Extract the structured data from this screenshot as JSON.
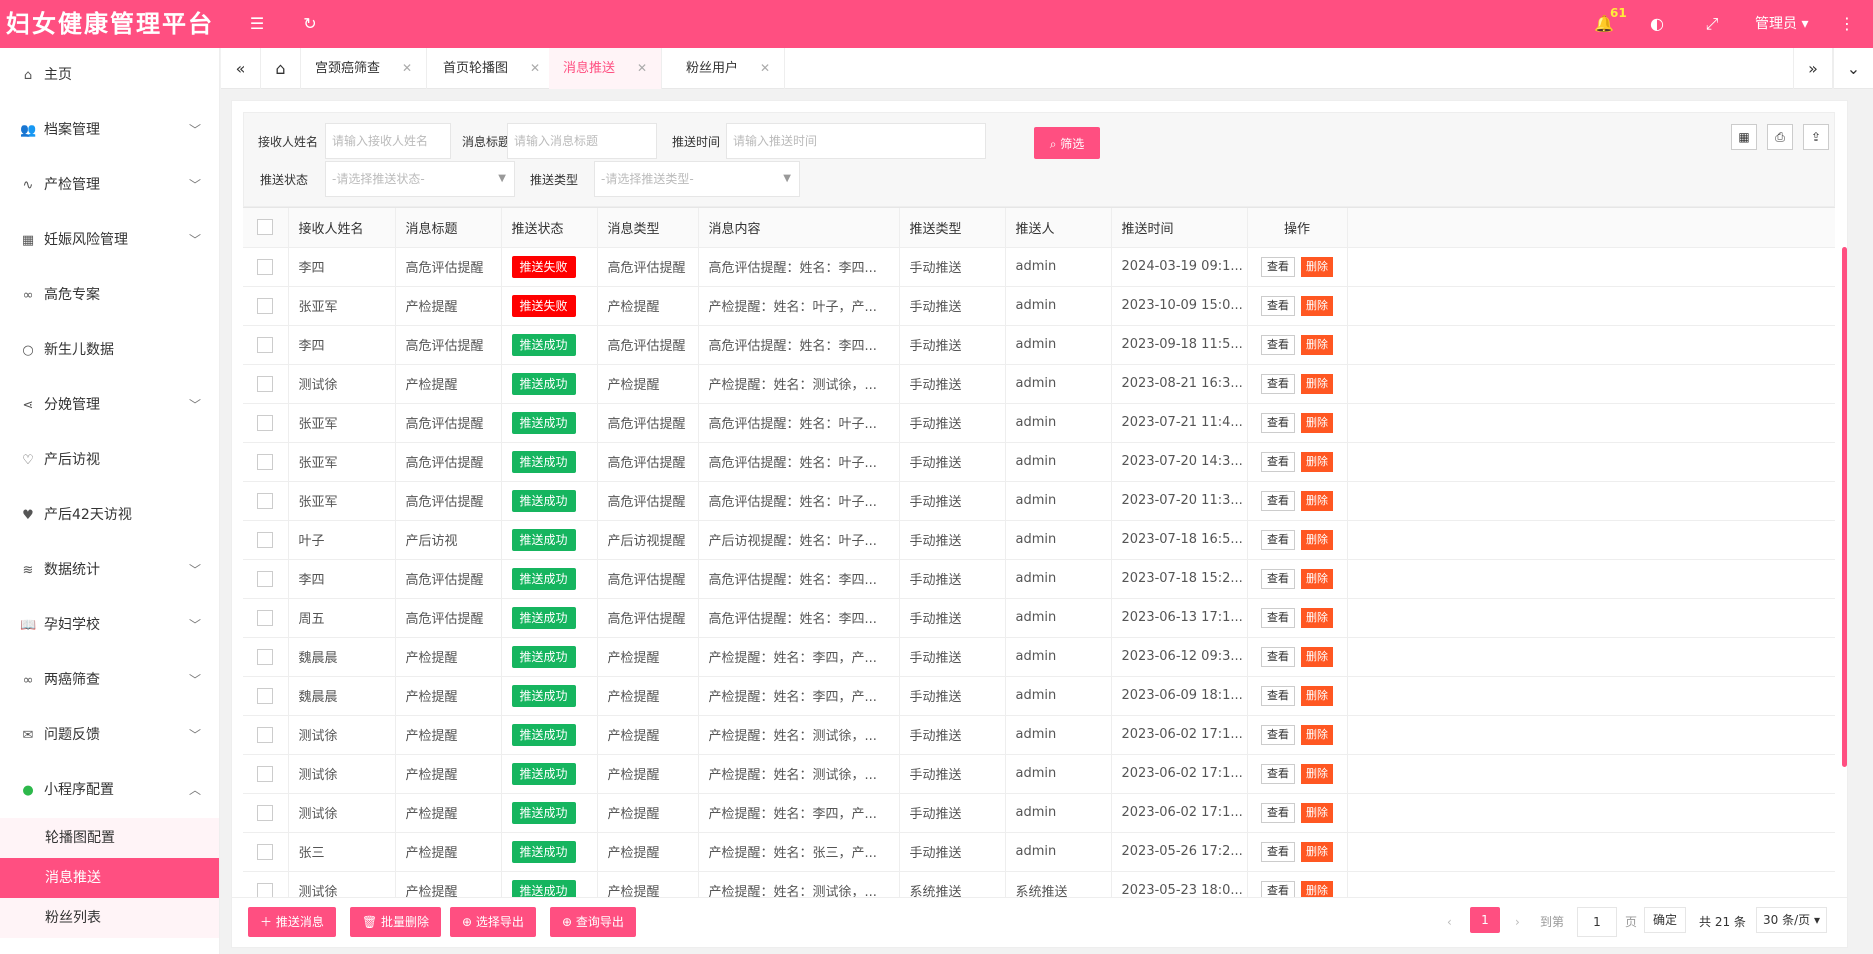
{
  "app": {
    "title": "妇女健康管理平台"
  },
  "header": {
    "notification_count": "61",
    "user": "管理员 ▾"
  },
  "sidebar": {
    "items": [
      {
        "icon": "home-icon",
        "glyph": "⌂",
        "label": "主页",
        "has_children": false
      },
      {
        "icon": "users-icon",
        "glyph": "👥",
        "label": "档案管理",
        "has_children": true
      },
      {
        "icon": "pulse-icon",
        "glyph": "∿",
        "label": "产检管理",
        "has_children": true
      },
      {
        "icon": "grid-icon",
        "glyph": "▦",
        "label": "妊娠风险管理",
        "has_children": true
      },
      {
        "icon": "infinity-icon",
        "glyph": "∞",
        "label": "高危专案",
        "has_children": false
      },
      {
        "icon": "circle-icon",
        "glyph": "○",
        "label": "新生儿数据",
        "has_children": false
      },
      {
        "icon": "share-icon",
        "glyph": "⋖",
        "label": "分娩管理",
        "has_children": true
      },
      {
        "icon": "heart-outline-icon",
        "glyph": "♡",
        "label": "产后访视",
        "has_children": false
      },
      {
        "icon": "heart-icon",
        "glyph": "♥",
        "label": "产后42天访视",
        "has_children": false
      },
      {
        "icon": "layers-icon",
        "glyph": "≋",
        "label": "数据统计",
        "has_children": true
      },
      {
        "icon": "book-icon",
        "glyph": "📖",
        "label": "孕妇学校",
        "has_children": true
      },
      {
        "icon": "infinity-icon",
        "glyph": "∞",
        "label": "两癌筛查",
        "has_children": true
      },
      {
        "icon": "mail-icon",
        "glyph": "✉",
        "label": "问题反馈",
        "has_children": true
      },
      {
        "icon": "wechat-icon",
        "glyph": "●",
        "label": "小程序配置",
        "has_children": true,
        "expanded": true
      }
    ],
    "subitems": [
      {
        "label": "轮播图配置",
        "active": false
      },
      {
        "label": "消息推送",
        "active": true
      },
      {
        "label": "粉丝列表",
        "active": false
      }
    ]
  },
  "tabs": [
    {
      "label": "宫颈癌筛查",
      "active": false
    },
    {
      "label": "首页轮播图",
      "active": false
    },
    {
      "label": "消息推送",
      "active": true
    },
    {
      "label": "粉丝用户",
      "active": false
    }
  ],
  "filter": {
    "receiver_label": "接收人姓名",
    "receiver_placeholder": "请输入接收人姓名",
    "title_label": "消息标题",
    "title_placeholder": "请输入消息标题",
    "time_label": "推送时间",
    "time_placeholder": "请输入推送时间",
    "button": "筛选",
    "status_label": "推送状态",
    "status_placeholder": "-请选择推送状态-",
    "type_label": "推送类型",
    "type_placeholder": "-请选择推送类型-"
  },
  "table": {
    "headers": [
      "接收人姓名",
      "消息标题",
      "推送状态",
      "消息类型",
      "消息内容",
      "推送类型",
      "推送人",
      "推送时间",
      "操作"
    ],
    "view_label": "查看",
    "delete_label": "删除",
    "rows": [
      {
        "name": "李四",
        "title": "高危评估提醒",
        "status": "推送失败",
        "ok": false,
        "type": "高危评估提醒",
        "content": "高危评估提醒：姓名：李四...",
        "push_type": "手动推送",
        "pusher": "admin",
        "time": "2024-03-19 09:1..."
      },
      {
        "name": "张亚军",
        "title": "产检提醒",
        "status": "推送失败",
        "ok": false,
        "type": "产检提醒",
        "content": "产检提醒：姓名：叶子，产...",
        "push_type": "手动推送",
        "pusher": "admin",
        "time": "2023-10-09 15:0..."
      },
      {
        "name": "李四",
        "title": "高危评估提醒",
        "status": "推送成功",
        "ok": true,
        "type": "高危评估提醒",
        "content": "高危评估提醒：姓名：李四...",
        "push_type": "手动推送",
        "pusher": "admin",
        "time": "2023-09-18 11:5..."
      },
      {
        "name": "测试徐",
        "title": "产检提醒",
        "status": "推送成功",
        "ok": true,
        "type": "产检提醒",
        "content": "产检提醒：姓名：测试徐，...",
        "push_type": "手动推送",
        "pusher": "admin",
        "time": "2023-08-21 16:3..."
      },
      {
        "name": "张亚军",
        "title": "高危评估提醒",
        "status": "推送成功",
        "ok": true,
        "type": "高危评估提醒",
        "content": "高危评估提醒：姓名：叶子...",
        "push_type": "手动推送",
        "pusher": "admin",
        "time": "2023-07-21 11:4..."
      },
      {
        "name": "张亚军",
        "title": "高危评估提醒",
        "status": "推送成功",
        "ok": true,
        "type": "高危评估提醒",
        "content": "高危评估提醒：姓名：叶子...",
        "push_type": "手动推送",
        "pusher": "admin",
        "time": "2023-07-20 14:3..."
      },
      {
        "name": "张亚军",
        "title": "高危评估提醒",
        "status": "推送成功",
        "ok": true,
        "type": "高危评估提醒",
        "content": "高危评估提醒：姓名：叶子...",
        "push_type": "手动推送",
        "pusher": "admin",
        "time": "2023-07-20 11:3..."
      },
      {
        "name": "叶子",
        "title": "产后访视",
        "status": "推送成功",
        "ok": true,
        "type": "产后访视提醒",
        "content": "产后访视提醒：姓名：叶子...",
        "push_type": "手动推送",
        "pusher": "admin",
        "time": "2023-07-18 16:5..."
      },
      {
        "name": "李四",
        "title": "高危评估提醒",
        "status": "推送成功",
        "ok": true,
        "type": "高危评估提醒",
        "content": "高危评估提醒：姓名：李四...",
        "push_type": "手动推送",
        "pusher": "admin",
        "time": "2023-07-18 15:2..."
      },
      {
        "name": "周五",
        "title": "高危评估提醒",
        "status": "推送成功",
        "ok": true,
        "type": "高危评估提醒",
        "content": "高危评估提醒：姓名：李四...",
        "push_type": "手动推送",
        "pusher": "admin",
        "time": "2023-06-13 17:1..."
      },
      {
        "name": "魏晨晨",
        "title": "产检提醒",
        "status": "推送成功",
        "ok": true,
        "type": "产检提醒",
        "content": "产检提醒：姓名：李四，产...",
        "push_type": "手动推送",
        "pusher": "admin",
        "time": "2023-06-12 09:3..."
      },
      {
        "name": "魏晨晨",
        "title": "产检提醒",
        "status": "推送成功",
        "ok": true,
        "type": "产检提醒",
        "content": "产检提醒：姓名：李四，产...",
        "push_type": "手动推送",
        "pusher": "admin",
        "time": "2023-06-09 18:1..."
      },
      {
        "name": "测试徐",
        "title": "产检提醒",
        "status": "推送成功",
        "ok": true,
        "type": "产检提醒",
        "content": "产检提醒：姓名：测试徐，...",
        "push_type": "手动推送",
        "pusher": "admin",
        "time": "2023-06-02 17:1..."
      },
      {
        "name": "测试徐",
        "title": "产检提醒",
        "status": "推送成功",
        "ok": true,
        "type": "产检提醒",
        "content": "产检提醒：姓名：测试徐，...",
        "push_type": "手动推送",
        "pusher": "admin",
        "time": "2023-06-02 17:1..."
      },
      {
        "name": "测试徐",
        "title": "产检提醒",
        "status": "推送成功",
        "ok": true,
        "type": "产检提醒",
        "content": "产检提醒：姓名：李四，产...",
        "push_type": "手动推送",
        "pusher": "admin",
        "time": "2023-06-02 17:1..."
      },
      {
        "name": "张三",
        "title": "产检提醒",
        "status": "推送成功",
        "ok": true,
        "type": "产检提醒",
        "content": "产检提醒：姓名：张三，产...",
        "push_type": "手动推送",
        "pusher": "admin",
        "time": "2023-05-26 17:2..."
      },
      {
        "name": "测试徐",
        "title": "产检提醒",
        "status": "推送成功",
        "ok": true,
        "type": "产检提醒",
        "content": "产检提醒：姓名：测试徐，...",
        "push_type": "系统推送",
        "pusher": "系统推送",
        "time": "2023-05-23 18:0..."
      }
    ]
  },
  "actions": {
    "push": "＋ 推送消息",
    "batch_delete": "🗑 批量删除",
    "export_selected": "⊕ 选择导出",
    "export_query": "⊕ 查询导出"
  },
  "pagination": {
    "current_page": "1",
    "goto_label": "到第",
    "goto_value": "1",
    "page_unit": "页",
    "confirm": "确定",
    "total": "共 21 条",
    "page_size": "30 条/页 ▾"
  },
  "colors": {
    "primary": "#ff4f81",
    "success": "#16b55f",
    "fail": "#ff0000",
    "delete": "#ff5722"
  }
}
